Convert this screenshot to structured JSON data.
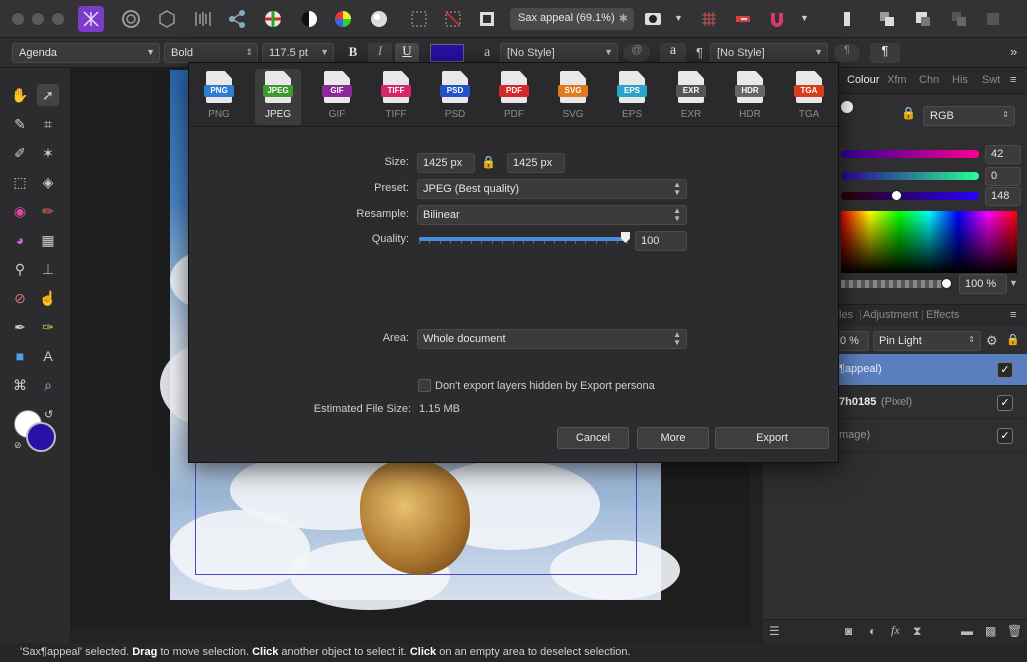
{
  "document": {
    "name": "Sax appeal (69.1%)"
  },
  "context_toolbar": {
    "font_family": "Agenda",
    "font_style": "Bold",
    "font_size": "117.5 pt",
    "bold_glyph": "B",
    "italic_glyph": "I",
    "underline_glyph": "U",
    "text_color": "#2a0ea8",
    "char_style": "[No Style]",
    "para_style": "[No Style]",
    "glyph_a": "a",
    "glyph_pilcrow": "¶"
  },
  "export_dialog": {
    "formats": [
      {
        "label": "PNG",
        "color": "#2d7dd2"
      },
      {
        "label": "JPEG",
        "color": "#3e9a2e"
      },
      {
        "label": "GIF",
        "color": "#8a2a9a"
      },
      {
        "label": "TIFF",
        "color": "#d4286a"
      },
      {
        "label": "PSD",
        "color": "#2152c8"
      },
      {
        "label": "PDF",
        "color": "#d42a2a"
      },
      {
        "label": "SVG",
        "color": "#e07a1c"
      },
      {
        "label": "EPS",
        "color": "#2aa5c8"
      },
      {
        "label": "EXR",
        "color": "#555555"
      },
      {
        "label": "HDR",
        "color": "#666666"
      },
      {
        "label": "TGA",
        "color": "#d4401c"
      }
    ],
    "selected_format": "JPEG",
    "size_label": "Size:",
    "width": "1425 px",
    "height": "1425 px",
    "preset_label": "Preset:",
    "preset": "JPEG (Best quality)",
    "resample_label": "Resample:",
    "resample": "Bilinear",
    "quality_label": "Quality:",
    "quality": "100",
    "quality_fraction": 1.0,
    "area_label": "Area:",
    "area": "Whole document",
    "hidden_layers_checkbox": "Don't export layers hidden by Export persona",
    "estimated_label": "Estimated File Size:",
    "estimated_size": "1.15 MB",
    "cancel": "Cancel",
    "more": "More",
    "export": "Export"
  },
  "colour_panel": {
    "tabs": [
      "Colour",
      "Xfm",
      "Chn",
      "His",
      "Swt"
    ],
    "mode": "RGB",
    "values": [
      "42",
      "0",
      "148"
    ],
    "opacity": "100 %"
  },
  "layers_panel": {
    "tabs": [
      "les",
      "Adjustment",
      "Effects"
    ],
    "opacity": "0 %",
    "blend_mode": "Pin Light",
    "layers": [
      {
        "name": "¶appeal)",
        "kind": "",
        "checked": "✓"
      },
      {
        "name": "7h0185",
        "kind": "(Pixel)",
        "checked": "✓"
      },
      {
        "name": "mage)",
        "kind": "",
        "checked": "✓"
      }
    ]
  },
  "status": {
    "p1": "'Sax¶appeal' selected. ",
    "b1": "Drag",
    "p2": " to move selection. ",
    "b2": "Click",
    "p3": " another object to select it. ",
    "b3": "Click",
    "p4": " on an empty area to deselect selection."
  }
}
